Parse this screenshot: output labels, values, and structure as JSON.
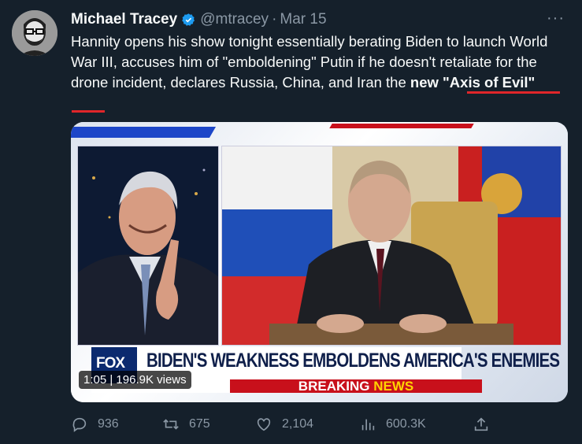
{
  "tweet": {
    "author_name": "Michael Tracey",
    "handle": "@mtracey",
    "separator": "·",
    "date": "Mar 15",
    "more": "···",
    "text_before": "Hannity opens his show tonight essentially berating Biden to launch World War III, accuses him of \"emboldening\" Putin if he doesn't retaliate for the drone incident, declares Russia, China, and Iran the ",
    "text_highlight": "new \"Axis of Evil\""
  },
  "media": {
    "banner_text": "BIDEN'S WEAKNESS EMBOLDENS AMERICA'S ENEMIES",
    "breaking": "BREAKING",
    "news": "NEWS",
    "fox_logo": "FOX",
    "video_counter": "1:05 | 196.9K views"
  },
  "actions": {
    "replies": "936",
    "retweets": "675",
    "likes": "2,104",
    "views": "600.3K"
  },
  "colors": {
    "background": "#15202b",
    "secondary_text": "#8b98a5",
    "verified_blue": "#1d9bf0",
    "underline_red": "#e0262a"
  }
}
